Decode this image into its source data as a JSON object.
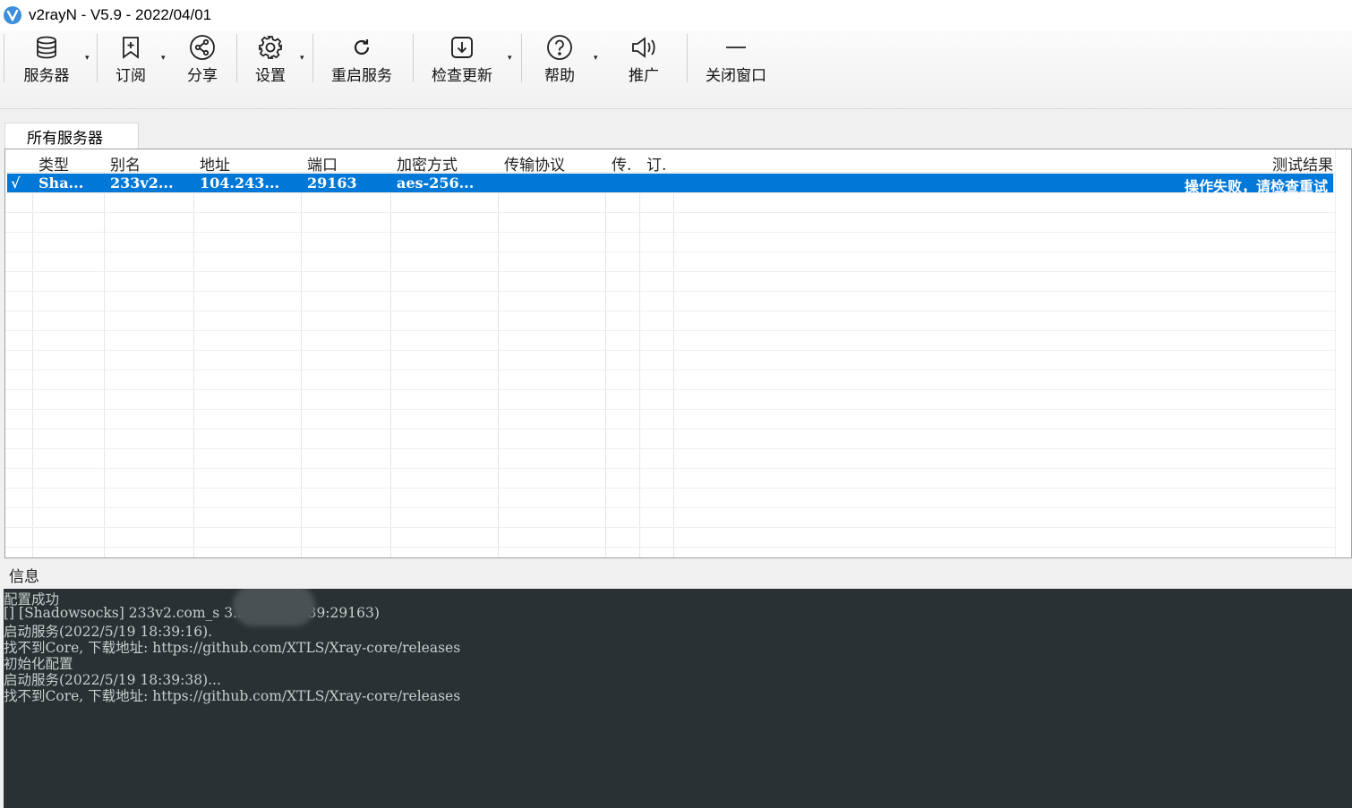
{
  "window": {
    "title": "v2rayN - V5.9 - 2022/04/01"
  },
  "toolbar": {
    "servers": "服务器",
    "subscribe": "订阅",
    "share": "分享",
    "settings": "设置",
    "restart": "重启服务",
    "check_update": "检查更新",
    "help": "帮助",
    "promote": "推广",
    "close_window": "关闭窗口",
    "dropdown_glyph": "▾"
  },
  "tabs": [
    {
      "label": "所有服务器"
    }
  ],
  "grid": {
    "columns": [
      "类型",
      "别名",
      "地址",
      "端口",
      "加密方式",
      "传输协议",
      "传.",
      "订.",
      "测试结果"
    ],
    "rows": [
      {
        "check": "√",
        "type": "Sha...",
        "alias": "233v2...",
        "address": "104.243...",
        "port": "29163",
        "security": "aes-256...",
        "transport": "",
        "tls": "",
        "sub": "",
        "test_result": "操作失败，请检查重试"
      }
    ]
  },
  "info": {
    "label": "信息",
    "log_lines": [
      "配置成功",
      "[] [Shadowsocks] 233v2.com_s              3.39(104***39:29163)",
      "启动服务(2022/5/19 18:39:16).",
      "找不到Core, 下载地址: https://github.com/XTLS/Xray-core/releases",
      "初始化配置",
      "启动服务(2022/5/19 18:39:38)...",
      "找不到Core, 下载地址: https://github.com/XTLS/Xray-core/releases"
    ]
  },
  "colors": {
    "selection": "#0078d7",
    "log_bg": "#293133",
    "log_text": "#c9cdce",
    "logo": "#3c8ddc"
  }
}
